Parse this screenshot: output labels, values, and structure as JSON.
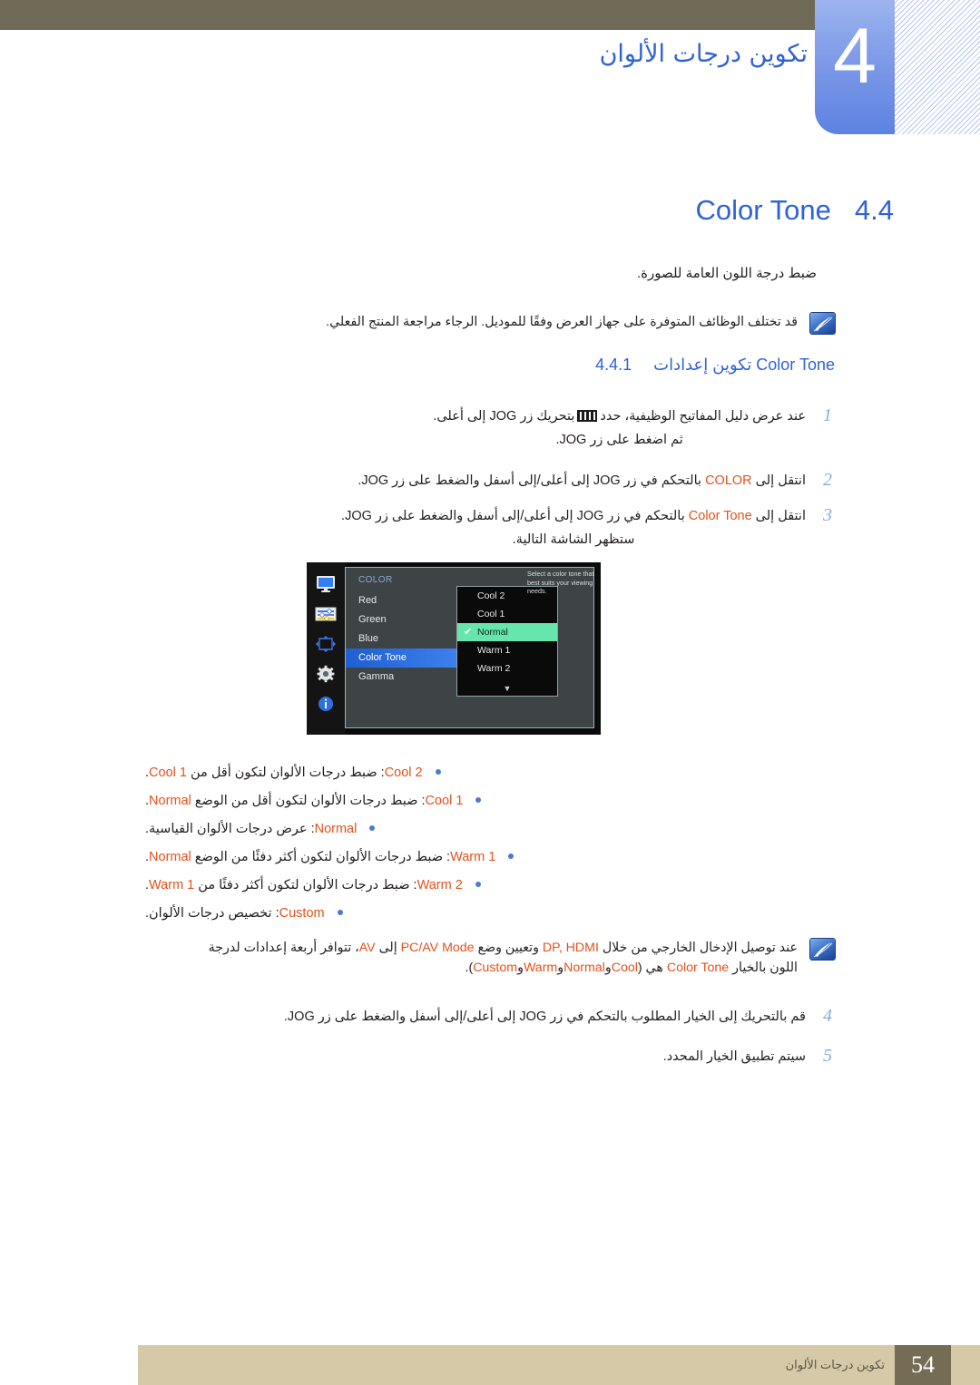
{
  "header": {
    "chapter_number": "4",
    "chapter_title": "تكوين درجات الألوان"
  },
  "section": {
    "number": "4.4",
    "title": "Color Tone",
    "lead": "ضبط درجة اللون العامة للصورة."
  },
  "note1": {
    "icon": "samsung-note-icon",
    "text": "قد تختلف الوظائف المتوفرة على جهاز العرض وفقًا للموديل. الرجاء مراجعة المنتج الفعلي."
  },
  "subsection": {
    "number": "4.4.1",
    "title_prefix": "تكوين إعدادات",
    "title_term": "Color Tone"
  },
  "steps": [
    {
      "num": "1",
      "line1_a": "عند عرض دليل المفاتيح الوظيفية، حدد",
      "glyph": "jog-key-guide-icon",
      "line1_b": "بتحريك زر JOG إلى أعلى.",
      "line2": "ثم اضغط على زر JOG."
    },
    {
      "num": "2",
      "line1_a": "انتقل إلى",
      "term": "COLOR",
      "line1_b": "بالتحكم في زر JOG إلى أعلى/إلى أسفل والضغط على زر JOG."
    },
    {
      "num": "3",
      "line1_a": "انتقل إلى",
      "term": "Color Tone",
      "line1_b": "بالتحكم في زر JOG إلى أعلى/إلى أسفل والضغط على زر JOG.",
      "line2": "ستظهر الشاشة التالية."
    },
    {
      "num": "4",
      "line1_a": "قم بالتحريك إلى الخيار المطلوب بالتحكم في زر JOG إلى أعلى/إلى أسفل والضغط على زر JOG."
    },
    {
      "num": "5",
      "line1_a": "سيتم تطبيق الخيار المحدد."
    }
  ],
  "osd": {
    "rail_icons": [
      "monitor-icon",
      "sliders-icon",
      "move-arrows-icon",
      "gear-icon",
      "info-icon"
    ],
    "category": "COLOR",
    "menu_items": [
      "Red",
      "Green",
      "Blue",
      "Color Tone",
      "Gamma"
    ],
    "selected_menu_item": "Color Tone",
    "dropdown_options": [
      "Cool 2",
      "Cool 1",
      "Normal",
      "Warm 1",
      "Warm 2"
    ],
    "dropdown_selected": "Normal",
    "dropdown_checkmark": "✔",
    "dropdown_more_caret": "▼",
    "help_text": "Select a color tone that best suits your viewing needs.",
    "accent_selected": "#3e82ef",
    "accent_highlight": "#66e5ad"
  },
  "bullets": [
    {
      "term": "Cool 2",
      "before": "",
      "after_a": ": ضبط درجات الألوان لتكون أقل من",
      "term2": "Cool 1",
      "after_b": "."
    },
    {
      "term": "Cool 1",
      "before": "",
      "after_a": ": ضبط درجات الألوان لتكون أقل من الوضع",
      "term2": "Normal",
      "after_b": "."
    },
    {
      "term": "Normal",
      "before": "",
      "after_a": ": عرض درجات الألوان القياسية.",
      "term2": "",
      "after_b": ""
    },
    {
      "term": "Warm 1",
      "before": "",
      "after_a": ": ضبط درجات الألوان لتكون أكثر دفئًا من الوضع",
      "term2": "Normal",
      "after_b": "."
    },
    {
      "term": "Warm 2",
      "before": "",
      "after_a": ": ضبط درجات الألوان لتكون أكثر دفئًا من",
      "term2": "Warm 1",
      "after_b": "."
    },
    {
      "term": "Custom",
      "before": "",
      "after_a": ": تخصيص درجات الألوان.",
      "term2": "",
      "after_b": ""
    }
  ],
  "note2": {
    "icon": "samsung-note-icon",
    "line1_a": "عند توصيل الإدخال الخارجي من خلال",
    "line1_t1": "DP, HDMI",
    "line1_b": "وتعيين وضع",
    "line1_t2": "PC/AV Mode",
    "line1_c": "إلى",
    "line1_t3": "AV",
    "line1_d": "، تتوافر أربعة إعدادات لدرجة",
    "line2_a": "اللون بالخيار",
    "line2_t1": "Color Tone",
    "line2_b": "هي (",
    "line2_t2": "Cool",
    "line2_c": "و",
    "line2_t3": "Normal",
    "line2_d": "و",
    "line2_t4": "Warm",
    "line2_e": "و",
    "line2_t5": "Custom",
    "line2_f": ")."
  },
  "footer": {
    "text": "تكوين درجات الألوان",
    "page": "54"
  },
  "colors": {
    "olive_bar": "#6e6a55",
    "chapter_blue": "#5d82e0",
    "heading_blue": "#2f62d8",
    "term_orange": "#e2521c",
    "footer_bar": "#d6c9a8",
    "footer_page_box": "#756c55"
  }
}
